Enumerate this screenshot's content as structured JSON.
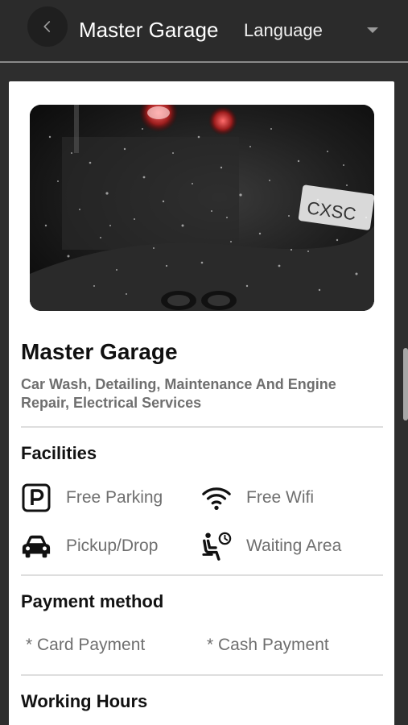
{
  "header": {
    "title": "Master Garage",
    "language_label": "Language"
  },
  "garage": {
    "name": "Master Garage",
    "services": "Car Wash, Detailing, Maintenance And Engine Repair, Electrical Services"
  },
  "facilities": {
    "title": "Facilities",
    "items": [
      {
        "label": "Free Parking",
        "icon": "parking-icon"
      },
      {
        "label": "Free Wifi",
        "icon": "wifi-icon"
      },
      {
        "label": "Pickup/Drop",
        "icon": "car-icon"
      },
      {
        "label": "Waiting Area",
        "icon": "waiting-area-icon"
      }
    ]
  },
  "payment": {
    "title": "Payment method",
    "methods": [
      "* Card Payment",
      "* Cash Payment"
    ]
  },
  "working_hours": {
    "title": "Working Hours"
  }
}
